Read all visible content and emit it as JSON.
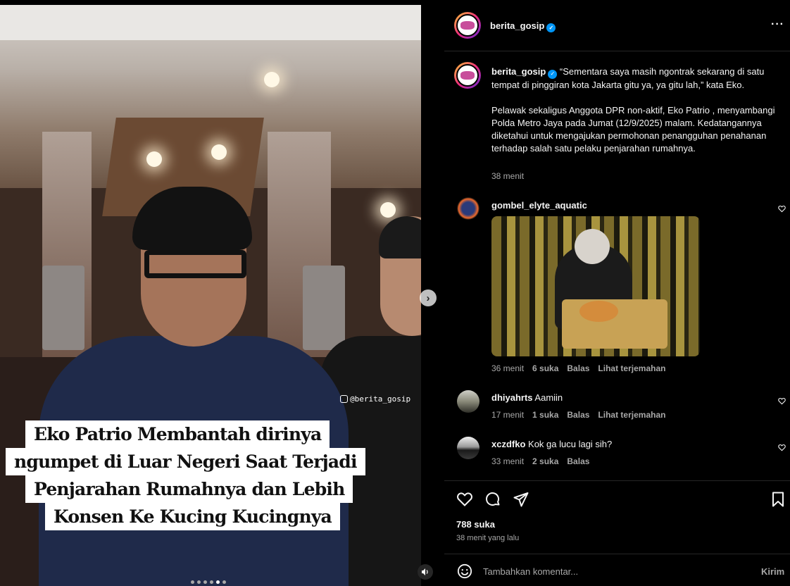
{
  "post": {
    "account": "berita_gosip",
    "verified": true,
    "caption_quote": "“Sementara saya masih ngontrak sekarang di satu tempat di pinggiran kota Jakarta gitu ya, ya gitu lah,” kata Eko.",
    "caption_body": "Pelawak sekaligus Anggota DPR non-aktif, Eko Patrio , menyambangi Polda Metro Jaya pada Jumat (12/9/2025) malam. Kedatangannya diketahui untuk mengajukan permohonan penangguhan penahanan terhadap salah satu pelaku penjarahan rumahnya.",
    "caption_time": "38 menit",
    "likes": "788 suka",
    "posted_ago": "38 menit yang lalu"
  },
  "media": {
    "watermark": "@berita_gosip",
    "overlay_lines": [
      "Eko Patrio Membantah dirinya",
      "ngumpet di Luar Negeri Saat Terjadi",
      "Penjarahan Rumahnya dan Lebih",
      "Konsen Ke Kucing Kucingnya"
    ],
    "carousel_count": 6,
    "carousel_active": 5,
    "next_icon": "chevron-right-icon",
    "sound_icon": "speaker-icon"
  },
  "comments": [
    {
      "user": "gombel_elyte_aquatic",
      "text": "",
      "has_gif": true,
      "time": "36 menit",
      "likes": "6 suka",
      "reply": "Balas",
      "translate": "Lihat terjemahan"
    },
    {
      "user": "dhiyahrts",
      "text": "Aamiin",
      "time": "17 menit",
      "likes": "1 suka",
      "reply": "Balas",
      "translate": "Lihat terjemahan"
    },
    {
      "user": "xczdfko",
      "text": "Kok ga lucu lagi sih?",
      "time": "33 menit",
      "likes": "2 suka",
      "reply": "Balas",
      "translate": ""
    }
  ],
  "comment_box": {
    "placeholder": "Tambahkan komentar...",
    "post_label": "Kirim"
  },
  "colors": {
    "background": "#000000",
    "text": "#f5f5f5",
    "secondary": "#a8a8a8",
    "verified": "#0095f6",
    "divider": "#262626"
  }
}
